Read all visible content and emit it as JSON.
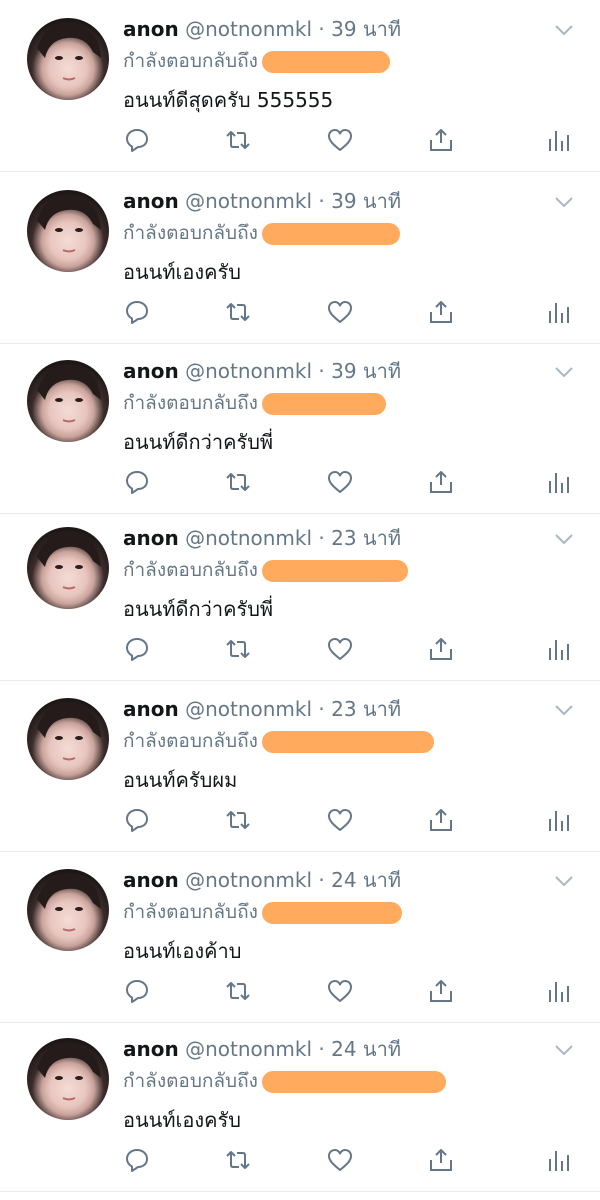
{
  "reply_prefix": "กำลังตอบกลับถึง",
  "separator": "·",
  "colors": {
    "redaction": "#ffaa5c",
    "secondary_text": "#657786",
    "primary_text": "#14171a",
    "icon": "#657786"
  },
  "icons": [
    "reply-icon",
    "retweet-icon",
    "like-icon",
    "share-icon",
    "analytics-icon",
    "chevron-down-icon"
  ],
  "tweets": [
    {
      "name": "anon",
      "handle": "@notnonmkl",
      "time": "39 นาที",
      "text": "อนนท์ดีสุดครับ 555555"
    },
    {
      "name": "anon",
      "handle": "@notnonmkl",
      "time": "39 นาที",
      "text": "อนนท์เองครับ"
    },
    {
      "name": "anon",
      "handle": "@notnonmkl",
      "time": "39 นาที",
      "text": "อนนท์ดีกว่าครับพี่"
    },
    {
      "name": "anon",
      "handle": "@notnonmkl",
      "time": "23 นาที",
      "text": "อนนท์ดีกว่าครับพี่"
    },
    {
      "name": "anon",
      "handle": "@notnonmkl",
      "time": "23 นาที",
      "text": "อนนท์ครับผม"
    },
    {
      "name": "anon",
      "handle": "@notnonmkl",
      "time": "24 นาที",
      "text": "อนนท์เองค้าบ"
    },
    {
      "name": "anon",
      "handle": "@notnonmkl",
      "time": "24 นาที",
      "text": "อนนท์เองครับ"
    }
  ]
}
